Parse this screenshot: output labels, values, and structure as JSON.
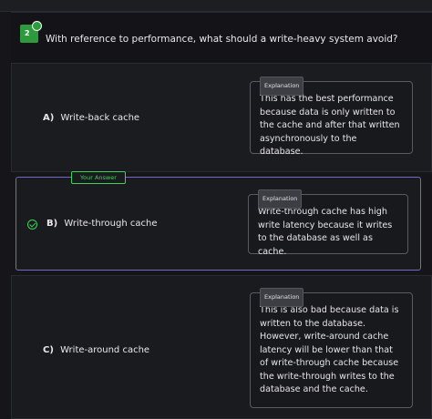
{
  "question": {
    "number": "2",
    "text": "With reference to performance, what should a write-heavy system avoid?"
  },
  "explanation_tag": "Explanation",
  "your_answer_tag": "Your Answer",
  "options": [
    {
      "letter": "A)",
      "label": "Write-back cache",
      "explanation": "This has the best performance because data is only written to the cache and after that written asynchronously to the database."
    },
    {
      "letter": "B)",
      "label": "Write-through cache",
      "explanation": "Write-through cache has high write latency because it writes to the database as well as cache."
    },
    {
      "letter": "C)",
      "label": "Write-around cache",
      "explanation": "This is also bad because data is written to the database. However, write-around cache latency will be lower than that of write-through cache because the write-through writes to the database and the cache."
    }
  ],
  "colors": {
    "accent": "#6f69c9",
    "correct": "#3ed05a",
    "badge": "#2e9a3e"
  }
}
